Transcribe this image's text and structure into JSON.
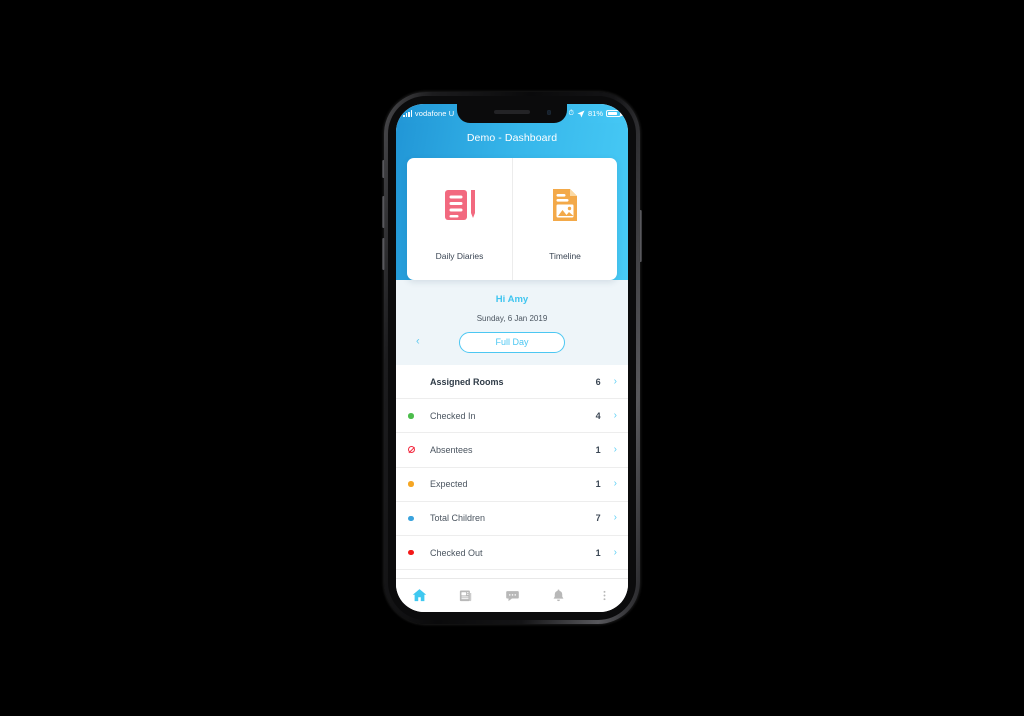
{
  "device": {
    "name": "iphone-x-mockup",
    "background_color": "#000000"
  },
  "status_bar": {
    "carrier": "vodafone U",
    "signal_icon": "signal-bars-icon",
    "alarm_icon": "alarm-icon",
    "location_icon": "location-arrow-icon",
    "battery_percent": "81%",
    "battery_icon": "battery-icon",
    "battery_level": 81
  },
  "header": {
    "title": "Demo - Dashboard",
    "gradient_from": "#2196d6",
    "gradient_to": "#48cbf6"
  },
  "quick_cards": [
    {
      "label": "Daily Diaries",
      "icon": "notebook-pencil-icon",
      "color": "#f2697f"
    },
    {
      "label": "Timeline",
      "icon": "document-photo-icon",
      "color": "#f5a council"
    }
  ],
  "quick_cards_fixed": [
    {
      "label": "Daily Diaries",
      "icon": "notebook-pencil-icon",
      "color": "#f2697f"
    },
    {
      "label": "Timeline",
      "icon": "document-photo-icon",
      "color": "#f3a949"
    }
  ],
  "greeting": {
    "hi": "Hi Amy",
    "date": "Sunday, 6 Jan 2019",
    "prev_icon": "chevron-left-icon",
    "period_button": "Full Day",
    "accent_color": "#4cc7f2",
    "background_color": "#eef5f9"
  },
  "list": {
    "chevron_icon": "chevron-right-icon",
    "rows": [
      {
        "label": "Assigned Rooms",
        "count": "6",
        "marker": "none",
        "marker_color": "",
        "bold": true
      },
      {
        "label": "Checked In",
        "count": "4",
        "marker": "dot",
        "marker_color": "#4cbd4c",
        "bold": false
      },
      {
        "label": "Absentees",
        "count": "1",
        "marker": "ban",
        "marker_color": "#f3283f",
        "bold": false
      },
      {
        "label": "Expected",
        "count": "1",
        "marker": "dot",
        "marker_color": "#f5a623",
        "bold": false
      },
      {
        "label": "Total Children",
        "count": "7",
        "marker": "dot",
        "marker_color": "#3aa3dd",
        "bold": false
      },
      {
        "label": "Checked Out",
        "count": "1",
        "marker": "dot",
        "marker_color": "#f41818",
        "bold": false
      }
    ]
  },
  "tab_bar": {
    "active_color": "#3fc8f0",
    "inactive_color": "#b8b8b8",
    "tabs": [
      {
        "name": "home",
        "icon": "home-icon",
        "active": true
      },
      {
        "name": "news",
        "icon": "newspaper-icon",
        "active": false
      },
      {
        "name": "messages",
        "icon": "chat-bubble-icon",
        "active": false
      },
      {
        "name": "notifications",
        "icon": "bell-icon",
        "active": false
      },
      {
        "name": "more",
        "icon": "overflow-menu-icon",
        "active": false
      }
    ]
  }
}
